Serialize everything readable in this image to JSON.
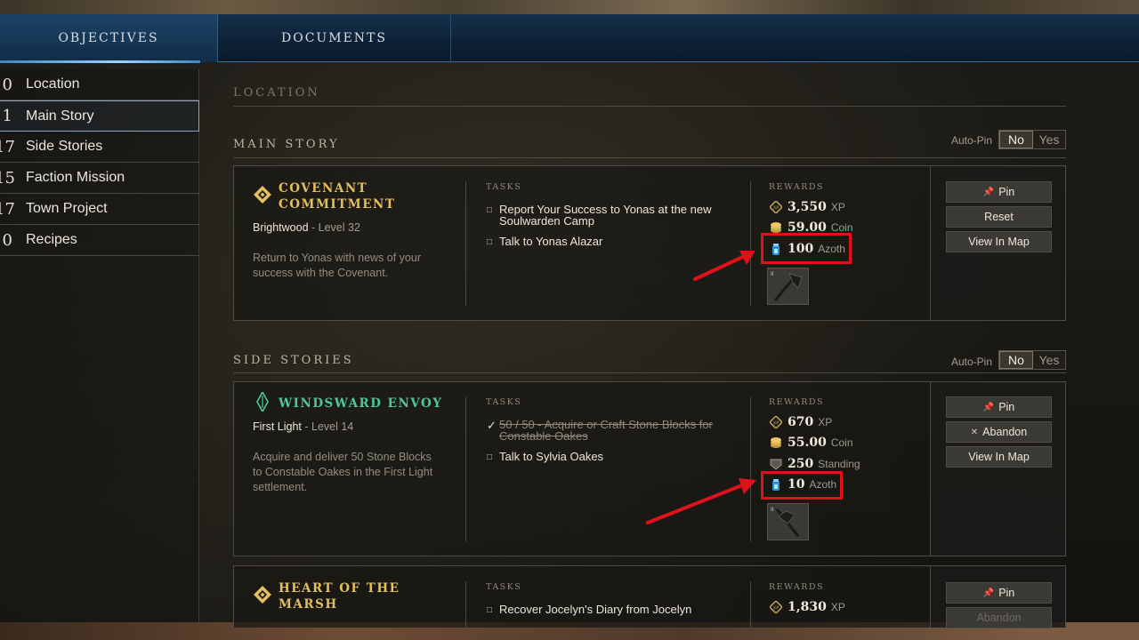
{
  "tabs": [
    {
      "label": "OBJECTIVES"
    },
    {
      "label": "DOCUMENTS"
    }
  ],
  "sidebar": {
    "items": [
      {
        "count": "0",
        "label": "Location"
      },
      {
        "count": "1",
        "label": "Main Story"
      },
      {
        "count": "17",
        "label": "Side Stories"
      },
      {
        "count": "15",
        "label": "Faction Mission"
      },
      {
        "count": "17",
        "label": "Town Project"
      },
      {
        "count": "0",
        "label": "Recipes"
      }
    ]
  },
  "sections": {
    "location": "LOCATION",
    "main_story": "MAIN STORY",
    "side_stories": "SIDE STORIES"
  },
  "autopin": {
    "label": "Auto-Pin",
    "no": "No",
    "yes": "Yes"
  },
  "headers": {
    "tasks": "TASKS",
    "rewards": "REWARDS"
  },
  "quests": [
    {
      "title_line1": "COVENANT",
      "title_line2": "COMMITMENT",
      "location": "Brightwood",
      "level": " - Level 32",
      "desc": "Return to Yonas with news of your success with the Covenant.",
      "tasks": [
        {
          "box": "□",
          "text": "Report Your Success to Yonas at the new Soulwarden Camp"
        },
        {
          "box": "□",
          "text": "Talk to Yonas Alazar"
        }
      ],
      "rewards": [
        {
          "value": "3,550",
          "unit": "XP",
          "icon": "xp-icon"
        },
        {
          "value": "59.00",
          "unit": "Coin",
          "icon": "coin-icon"
        },
        {
          "value": "100",
          "unit": "Azoth",
          "icon": "azoth-icon"
        }
      ],
      "buttons": [
        "Pin",
        "Reset",
        "View In Map"
      ]
    },
    {
      "title_line1": "WINDSWARD ENVOY",
      "location": "First Light",
      "level": " - Level 14",
      "desc": "Acquire and deliver 50 Stone Blocks to Constable Oakes in the First Light settlement.",
      "tasks": [
        {
          "box": "✓",
          "text": "50 / 50 - Acquire or Craft Stone Blocks for Constable Oakes"
        },
        {
          "box": "□",
          "text": "Talk to Sylvia Oakes"
        }
      ],
      "rewards": [
        {
          "value": "670",
          "unit": "XP",
          "icon": "xp-icon"
        },
        {
          "value": "55.00",
          "unit": "Coin",
          "icon": "coin-icon"
        },
        {
          "value": "250",
          "unit": "Standing",
          "icon": "standing-icon"
        },
        {
          "value": "10",
          "unit": "Azoth",
          "icon": "azoth-icon"
        }
      ],
      "buttons": [
        "Pin",
        "Abandon",
        "View In Map"
      ]
    },
    {
      "title_line1": "HEART OF THE",
      "title_line2": "MARSH",
      "tasks": [
        {
          "box": "□",
          "text": "Recover Jocelyn's Diary from Jocelyn"
        }
      ],
      "rewards": [
        {
          "value": "1,830",
          "unit": "XP",
          "icon": "xp-icon"
        }
      ],
      "buttons": [
        "Pin",
        "Abandon"
      ]
    }
  ],
  "colors": {
    "highlight": "#e0111b",
    "main_quest_title": "#e5bf5f",
    "side_quest_title": "#4fc79a",
    "tab_accent": "#9dd1ff"
  }
}
